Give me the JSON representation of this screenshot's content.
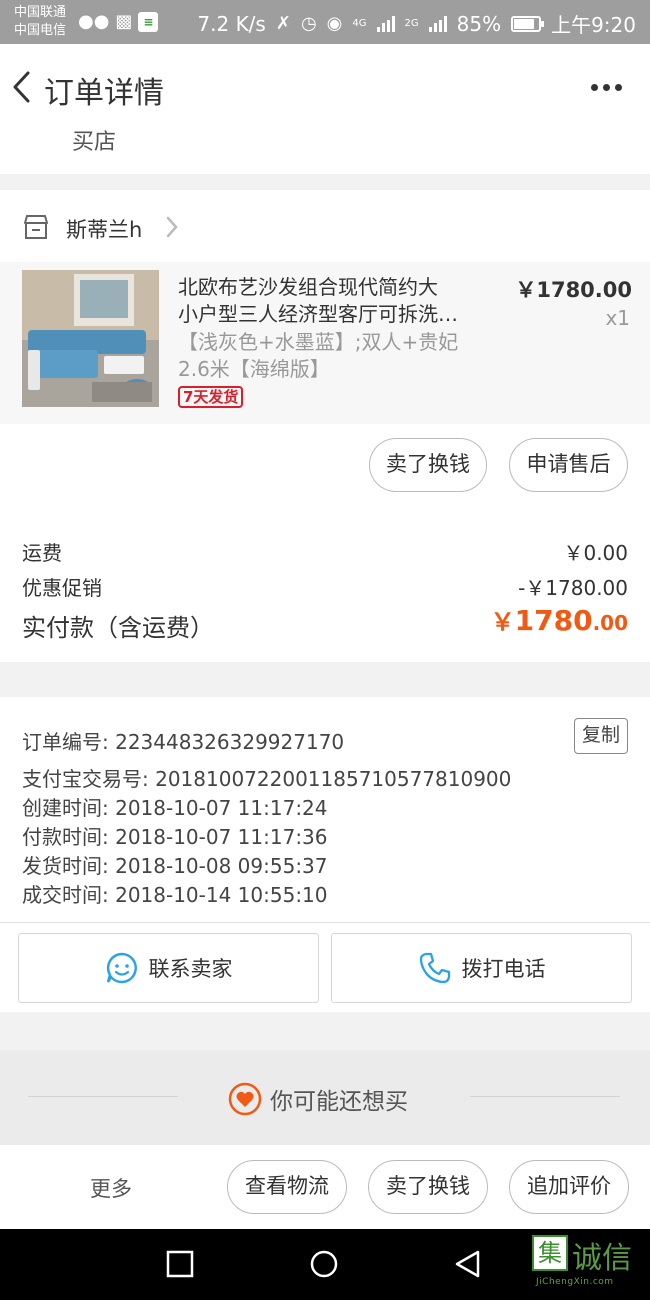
{
  "status_bar": {
    "carrier_1": "中国联通",
    "carrier_2": "中国电信",
    "speed": "7.2 K/s",
    "network_1": "4G",
    "network_2": "2G",
    "battery": "85%",
    "time": "上午9:20",
    "battery_level": 0.85
  },
  "nav": {
    "title": "订单详情"
  },
  "address": {
    "partial_text": "买店"
  },
  "shop": {
    "name": "斯蒂兰h"
  },
  "product": {
    "title_line_1": "北欧布艺沙发组合现代简约大",
    "title_line_2": "小户型三人经济型客厅可拆洗…",
    "spec_line_1": "【浅灰色+水墨蓝】;双人+贵妃",
    "spec_line_2": "2.6米【海绵版】",
    "badge": "7天发货",
    "price": "￥1780.00",
    "quantity": "x1",
    "actions": [
      "卖了换钱",
      "申请售后"
    ]
  },
  "price_summary": {
    "shipping_label": "运费",
    "shipping_value": "￥0.00",
    "discount_label": "优惠促销",
    "discount_value": "-￥1780.00",
    "total_label": "实付款（含运费）",
    "total_currency": "￥",
    "total_integer": "1780",
    "total_decimal": ".00"
  },
  "order_info": {
    "lines": [
      "订单编号: 223448326329927170",
      "支付宝交易号: 2018100722001185710577810900",
      "创建时间: 2018-10-07 11:17:24",
      "付款时间: 2018-10-07 11:17:36",
      "发货时间: 2018-10-08 09:55:37",
      "成交时间: 2018-10-14 10:55:10"
    ],
    "copy_label": "复制",
    "contact_seller": "联系卖家",
    "call_phone": "拨打电话"
  },
  "recommend": {
    "text": "你可能还想买"
  },
  "bottom_actions": {
    "more": "更多",
    "buttons": [
      "查看物流",
      "卖了换钱",
      "追加评价"
    ]
  },
  "watermark": {
    "logo_char": "集",
    "text": "诚信",
    "sub": "JiChengXin.com"
  },
  "colors": {
    "accent_orange": "#f05a14",
    "badge_red": "#d9202a",
    "icon_blue": "#2aa3e6"
  }
}
